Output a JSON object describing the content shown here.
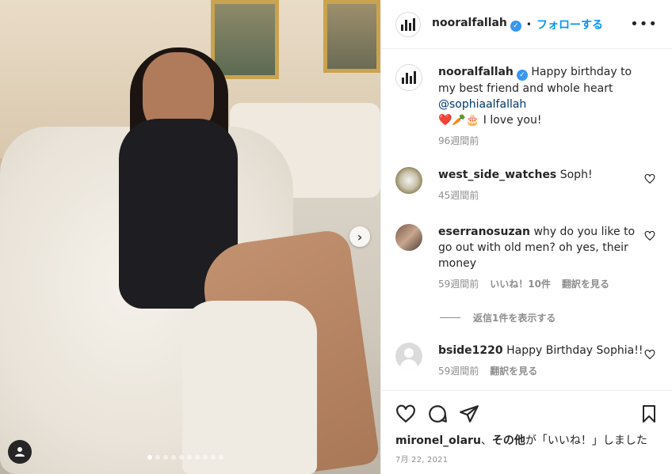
{
  "post": {
    "username": "nooralfallah",
    "follow_label": "フォローする",
    "more_label": "•••",
    "image_dots_count": 10,
    "image_active_dot": 0
  },
  "caption": {
    "username": "nooralfallah",
    "text": "Happy birthday to my best friend and whole heart",
    "mention": "@sophiaalfallah",
    "emoji_line": "❤️🥕🎂 I love you!",
    "time": "96週間前"
  },
  "comments": [
    {
      "username": "west_side_watches",
      "text": "Soph!",
      "time": "45週間前",
      "likes": "",
      "reply": ""
    },
    {
      "username": "eserranosuzan",
      "text": "why do you like to go out with old men? oh yes, their money",
      "time": "59週間前",
      "likes": "いいね！10件",
      "reply": "翻訳を見る"
    },
    {
      "username": "bside1220",
      "text": "Happy Birthday Sophia!!",
      "time": "59週間前",
      "likes": "",
      "reply": "翻訳を見る"
    }
  ],
  "view_replies": "返信1件を表示する",
  "likes_line": {
    "user": "mironel_olaru",
    "sep": "、",
    "others": "その他",
    "suffix": "が「いいね！」しました"
  },
  "date": "7月 22, 2021"
}
